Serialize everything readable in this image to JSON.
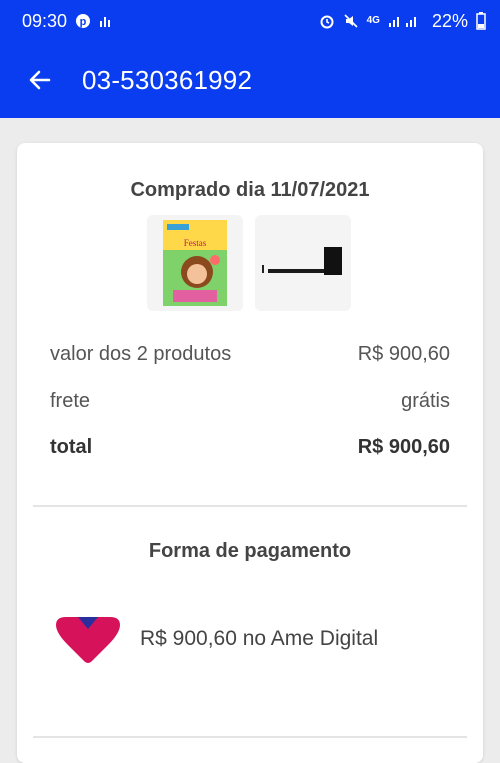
{
  "status_bar": {
    "time": "09:30",
    "network": "4G",
    "battery": "22%"
  },
  "header": {
    "title": "03-530361992"
  },
  "order": {
    "date_label": "Comprado dia 11/07/2021",
    "products": [
      {
        "icon": "book-cover-thumbnail"
      },
      {
        "icon": "soundbar-thumbnail"
      }
    ],
    "rows": [
      {
        "label": "valor dos 2 produtos",
        "value": "R$ 900,60"
      },
      {
        "label": "frete",
        "value": "grátis"
      },
      {
        "label": "total",
        "value": "R$ 900,60"
      }
    ]
  },
  "payment": {
    "title": "Forma de pagamento",
    "method_text": "R$ 900,60 no Ame Digital",
    "colors": {
      "ame_red": "#d6125a",
      "ame_blue": "#2b2f9e"
    }
  },
  "colors": {
    "brand_blue": "#0a3df0",
    "background": "#ececec"
  }
}
